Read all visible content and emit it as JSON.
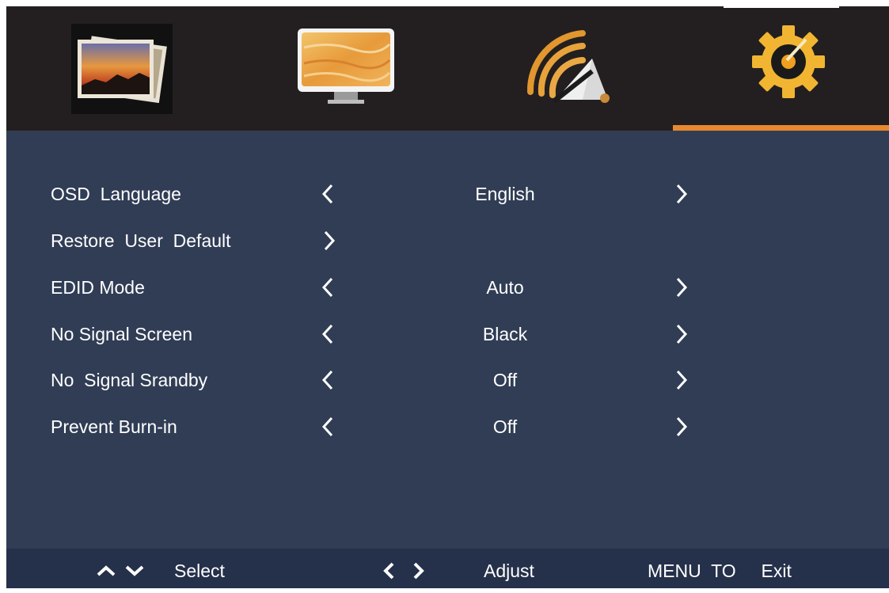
{
  "tabs": [
    {
      "icon": "picture-icon",
      "active": false
    },
    {
      "icon": "display-icon",
      "active": false
    },
    {
      "icon": "signal-icon",
      "active": false
    },
    {
      "icon": "gear-icon",
      "active": true
    }
  ],
  "colors": {
    "topbar_bg": "#231f20",
    "panel_bg": "#303d55",
    "helpbar_bg": "#25304a",
    "accent": "#e8892f",
    "text": "#ffffff"
  },
  "settings": [
    {
      "label": "OSD  Language",
      "value": "English",
      "has_value": true
    },
    {
      "label": "Restore  User  Default",
      "value": "",
      "has_value": false
    },
    {
      "label": "EDID Mode",
      "value": "Auto",
      "has_value": true
    },
    {
      "label": "No Signal Screen",
      "value": "Black",
      "has_value": true
    },
    {
      "label": "No  Signal Srandby",
      "value": "Off",
      "has_value": true
    },
    {
      "label": "Prevent Burn-in",
      "value": "Off",
      "has_value": true
    }
  ],
  "help": {
    "select_icons": [
      "chevron-up-icon",
      "chevron-down-icon"
    ],
    "select_label": "Select",
    "adjust_icons": [
      "chevron-left-icon",
      "chevron-right-icon"
    ],
    "adjust_label": "Adjust",
    "exit_label": "MENU  TO     Exit"
  }
}
